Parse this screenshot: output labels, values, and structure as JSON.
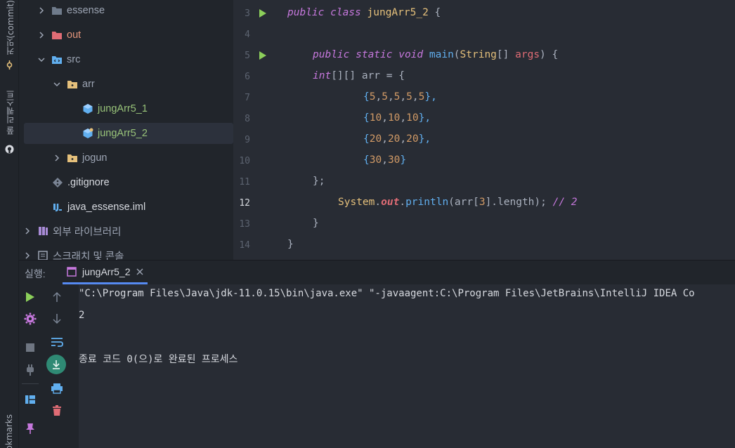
{
  "left_strip": {
    "commit_tab": "커밋(commit)",
    "pull_requests_tab": "풀 리퀘스트",
    "bookmarks_tab": "okmarks"
  },
  "project_tree": {
    "items": [
      {
        "label": "essense",
        "type": "folder",
        "expandable": true,
        "expanded": false
      },
      {
        "label": "out",
        "type": "folder-excluded",
        "expandable": true,
        "expanded": false
      },
      {
        "label": "src",
        "type": "source-folder",
        "expandable": true,
        "expanded": true
      },
      {
        "label": "arr",
        "type": "package",
        "expandable": true,
        "expanded": true
      },
      {
        "label": "jungArr5_1",
        "type": "java-class"
      },
      {
        "label": "jungArr5_2",
        "type": "java-class",
        "selected": true
      },
      {
        "label": "jogun",
        "type": "package",
        "expandable": true,
        "expanded": false
      },
      {
        "label": ".gitignore",
        "type": "git-file"
      },
      {
        "label": "java_essense.iml",
        "type": "module-file"
      },
      {
        "label": "외부 라이브러리",
        "type": "libraries",
        "expandable": true
      },
      {
        "label": "스크래치 및 콘솔",
        "type": "scratches",
        "expandable": true
      }
    ]
  },
  "editor": {
    "line_numbers": [
      "3",
      "4",
      "5",
      "6",
      "7",
      "8",
      "9",
      "10",
      "11",
      "12",
      "13",
      "14"
    ],
    "current_line": "12",
    "lines": {
      "l3_kw": "public class ",
      "l3_cls": "jungArr5_2",
      "l3_rest": " {",
      "l5_kw": "public static void ",
      "l5_fn": "main",
      "l5_p1": "(",
      "l5_type": "String",
      "l5_p2": "[] ",
      "l5_arg": "args",
      "l5_p3": ") {",
      "l6_kw": "int",
      "l6_rest": "[][] arr = {",
      "l7": [
        "{",
        "5",
        ",",
        "5",
        ",",
        "5",
        ",",
        "5",
        ",",
        "5",
        "},"
      ],
      "l8": [
        "{",
        "10",
        ",",
        "10",
        ",",
        "10",
        "},"
      ],
      "l9": [
        "{",
        "20",
        ",",
        "20",
        ",",
        "20",
        "},"
      ],
      "l10": [
        "{",
        "30",
        ",",
        "30",
        "}"
      ],
      "l11": "};",
      "l12_sys": "System",
      "l12_dot1": ".",
      "l12_out": "out",
      "l12_dot2": ".",
      "l12_fn": "println",
      "l12_p1": "(arr[",
      "l12_idx": "3",
      "l12_p2": "].length); ",
      "l12_cm": "// 2",
      "l13": "}",
      "l14": "}"
    }
  },
  "run_panel": {
    "label": "실행:",
    "tab_name": "jungArr5_2",
    "console_lines": [
      "\"C:\\Program Files\\Java\\jdk-11.0.15\\bin\\java.exe\" \"-javaagent:C:\\Program Files\\JetBrains\\IntelliJ IDEA Co",
      "2",
      "",
      "종료 코드 0(으)로 완료된 프로세스"
    ]
  },
  "colors": {
    "run_green": "#8ccf5a",
    "accent_blue": "#568af2",
    "stop_red": "#e06c75"
  }
}
